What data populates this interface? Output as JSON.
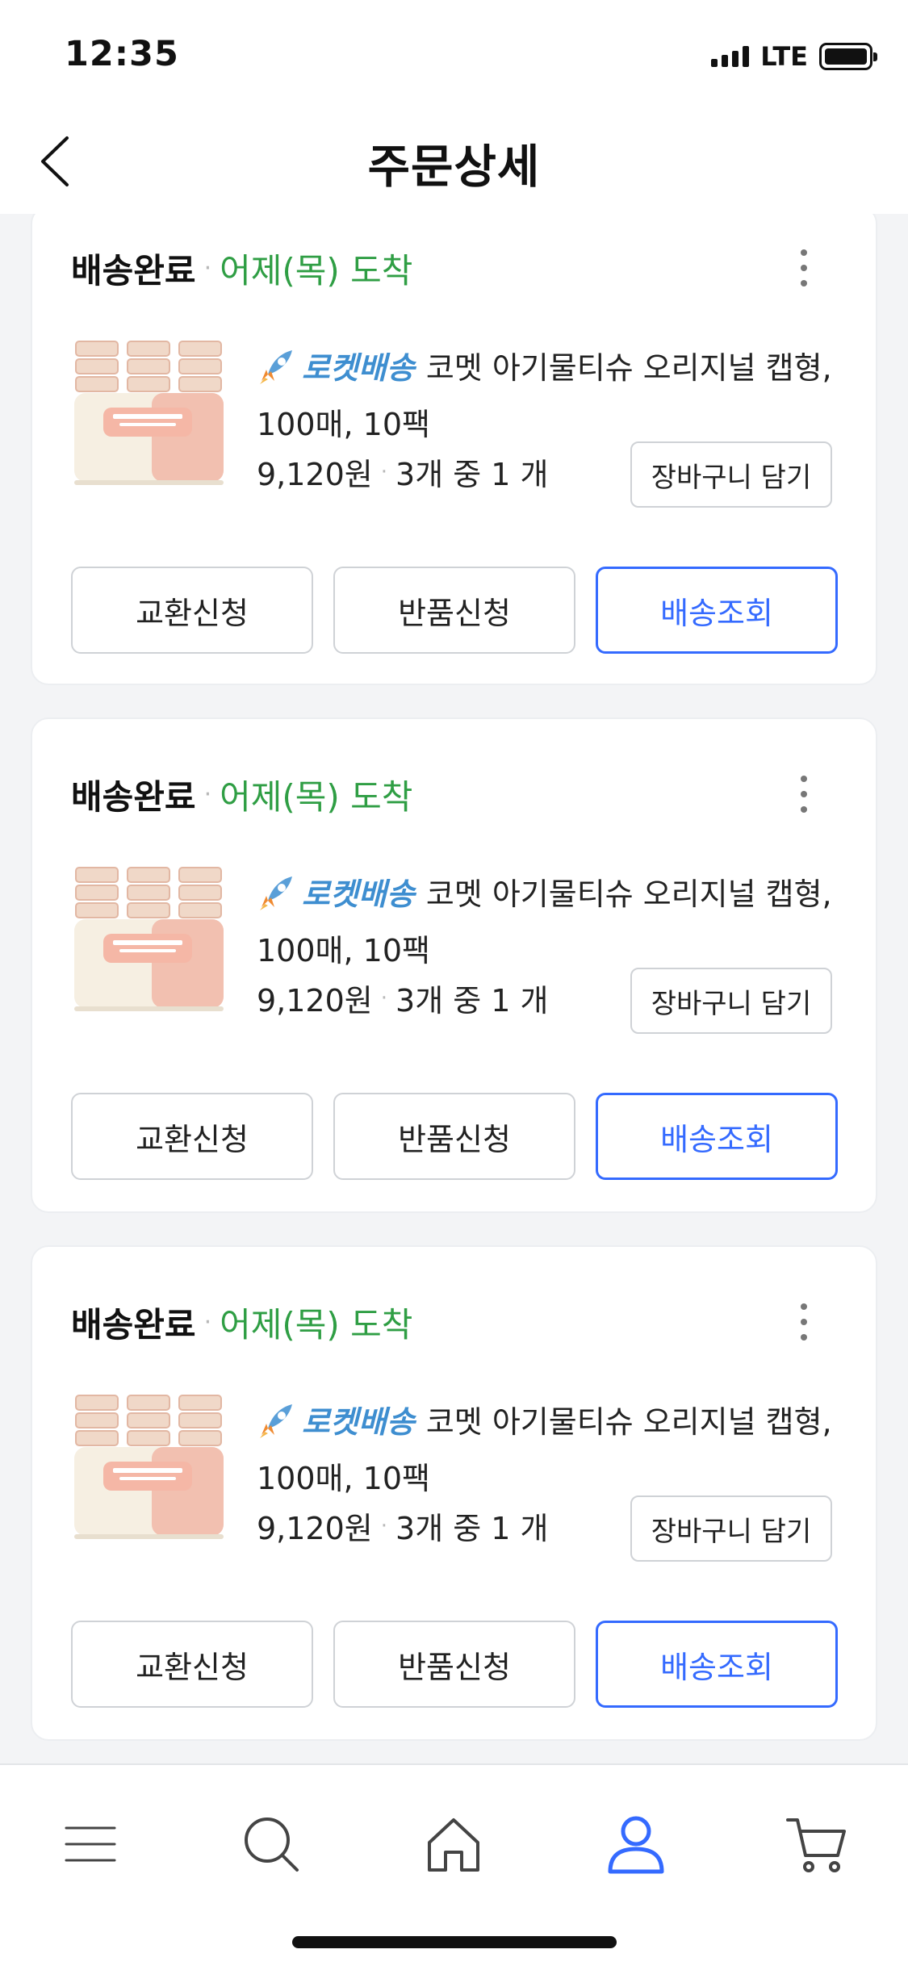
{
  "status_bar": {
    "time": "12:35",
    "network": "LTE"
  },
  "header": {
    "title": "주문상세"
  },
  "orders": [
    {
      "status": "배송완료",
      "arrival": "어제(목) 도착",
      "delivery_badge": "로켓배송",
      "product_name": "코멧 아기물티슈 오리지널 캡형,",
      "product_option": "100매, 10팩",
      "price": "9,120원",
      "quantity": "3개 중 1 개",
      "cart_button": "장바구니 담기",
      "actions": {
        "exchange": "교환신청",
        "return": "반품신청",
        "track": "배송조회"
      }
    },
    {
      "status": "배송완료",
      "arrival": "어제(목) 도착",
      "delivery_badge": "로켓배송",
      "product_name": "코멧 아기물티슈 오리지널 캡형,",
      "product_option": "100매, 10팩",
      "price": "9,120원",
      "quantity": "3개 중 1 개",
      "cart_button": "장바구니 담기",
      "actions": {
        "exchange": "교환신청",
        "return": "반품신청",
        "track": "배송조회"
      }
    },
    {
      "status": "배송완료",
      "arrival": "어제(목) 도착",
      "delivery_badge": "로켓배송",
      "product_name": "코멧 아기물티슈 오리지널 캡형,",
      "product_option": "100매, 10팩",
      "price": "9,120원",
      "quantity": "3개 중 1 개",
      "cart_button": "장바구니 담기",
      "actions": {
        "exchange": "교환신청",
        "return": "반품신청",
        "track": "배송조회"
      }
    }
  ],
  "colors": {
    "arrival_green": "#2f9e44",
    "rocket_blue": "#3e8ed0",
    "primary_blue": "#346aff",
    "active_tab": "#346aff"
  },
  "tab_bar": {
    "tabs": [
      "menu-icon",
      "search-icon",
      "home-icon",
      "my-account-icon",
      "cart-icon"
    ],
    "active": "my-account-icon"
  }
}
